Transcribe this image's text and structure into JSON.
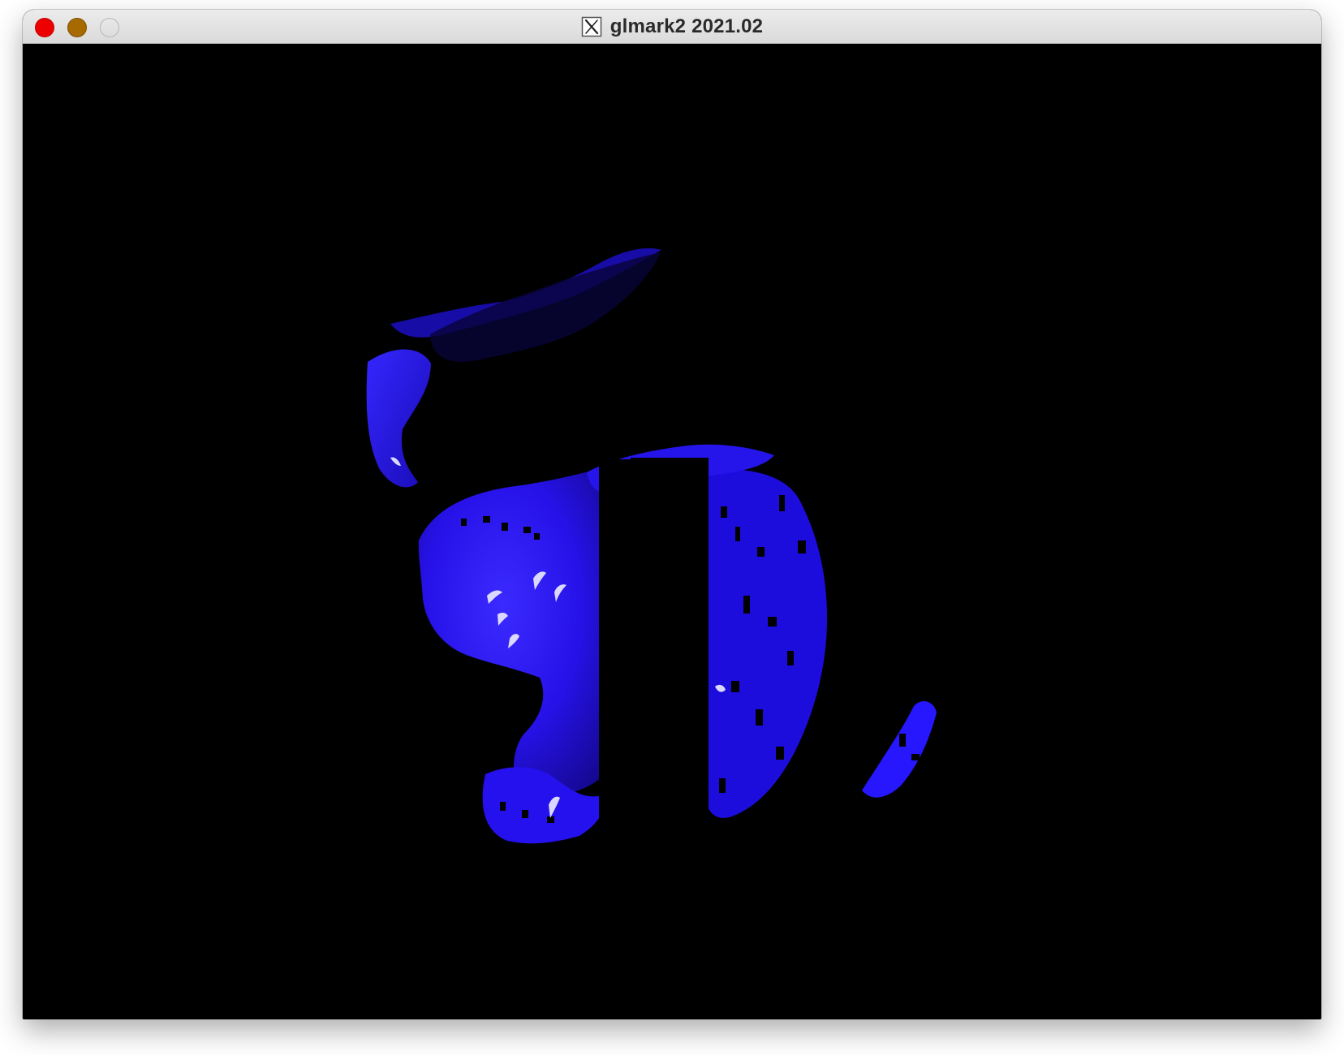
{
  "window": {
    "title": "glmark2 2021.02",
    "app_icon": "x11-icon"
  },
  "window_controls": {
    "close": {
      "icon": "close-dot-icon",
      "color": "#ec0000"
    },
    "minimize": {
      "icon": "minimize-dot-icon",
      "color": "#a66a00"
    },
    "zoom": {
      "icon": "zoom-dot-icon",
      "color": "#d9d9d9"
    }
  },
  "scene": {
    "background_color": "#000000",
    "model": "bunny",
    "render_color": "#2b16ff",
    "highlight_color": "#d8d6ff"
  }
}
